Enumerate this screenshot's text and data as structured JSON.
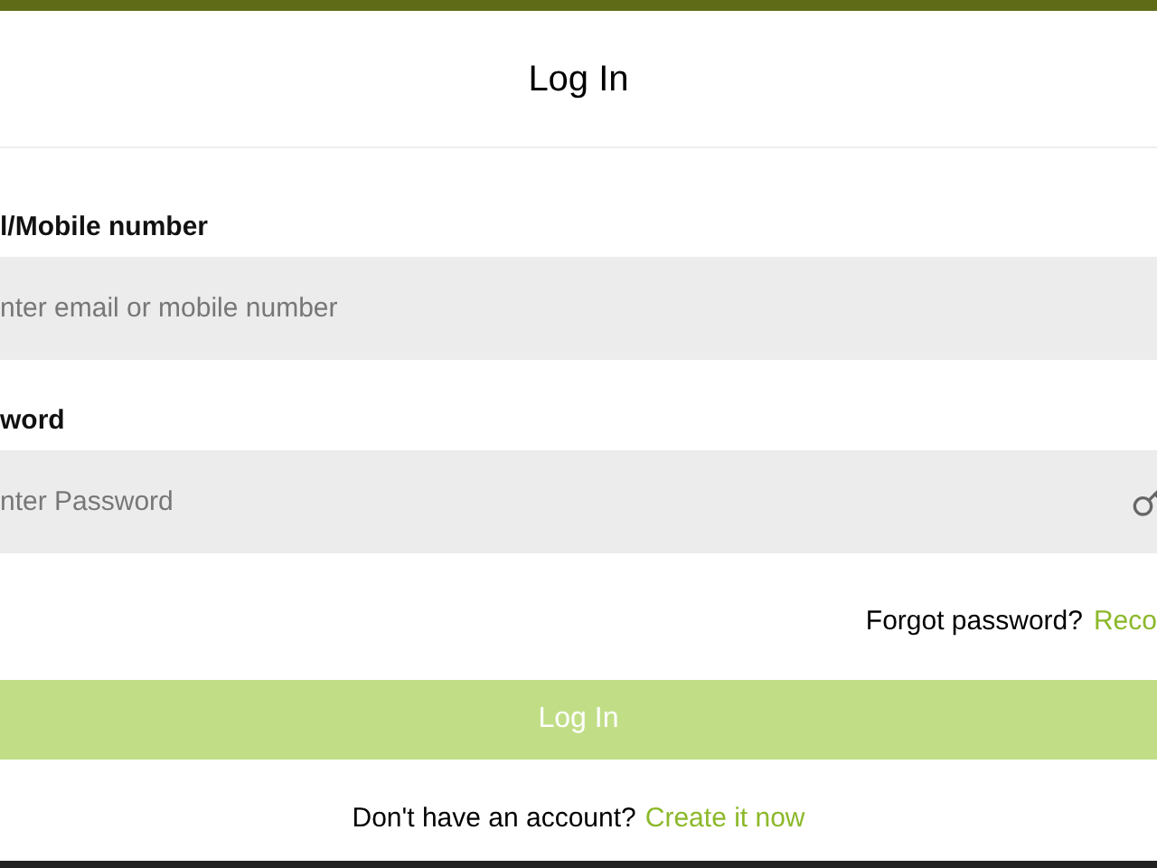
{
  "dialog": {
    "title": "Log In"
  },
  "fields": [
    {
      "label": "l/Mobile number",
      "placeholder": "nter email or mobile number",
      "kind": "text"
    },
    {
      "label": "word",
      "placeholder": "nter Password",
      "kind": "password"
    }
  ],
  "forgot": {
    "text": "Forgot password?",
    "link": "Reco"
  },
  "submit": {
    "label": "Log In",
    "disabled": true
  },
  "signup": {
    "text": "Don't have an account?",
    "link": "Create it now"
  }
}
